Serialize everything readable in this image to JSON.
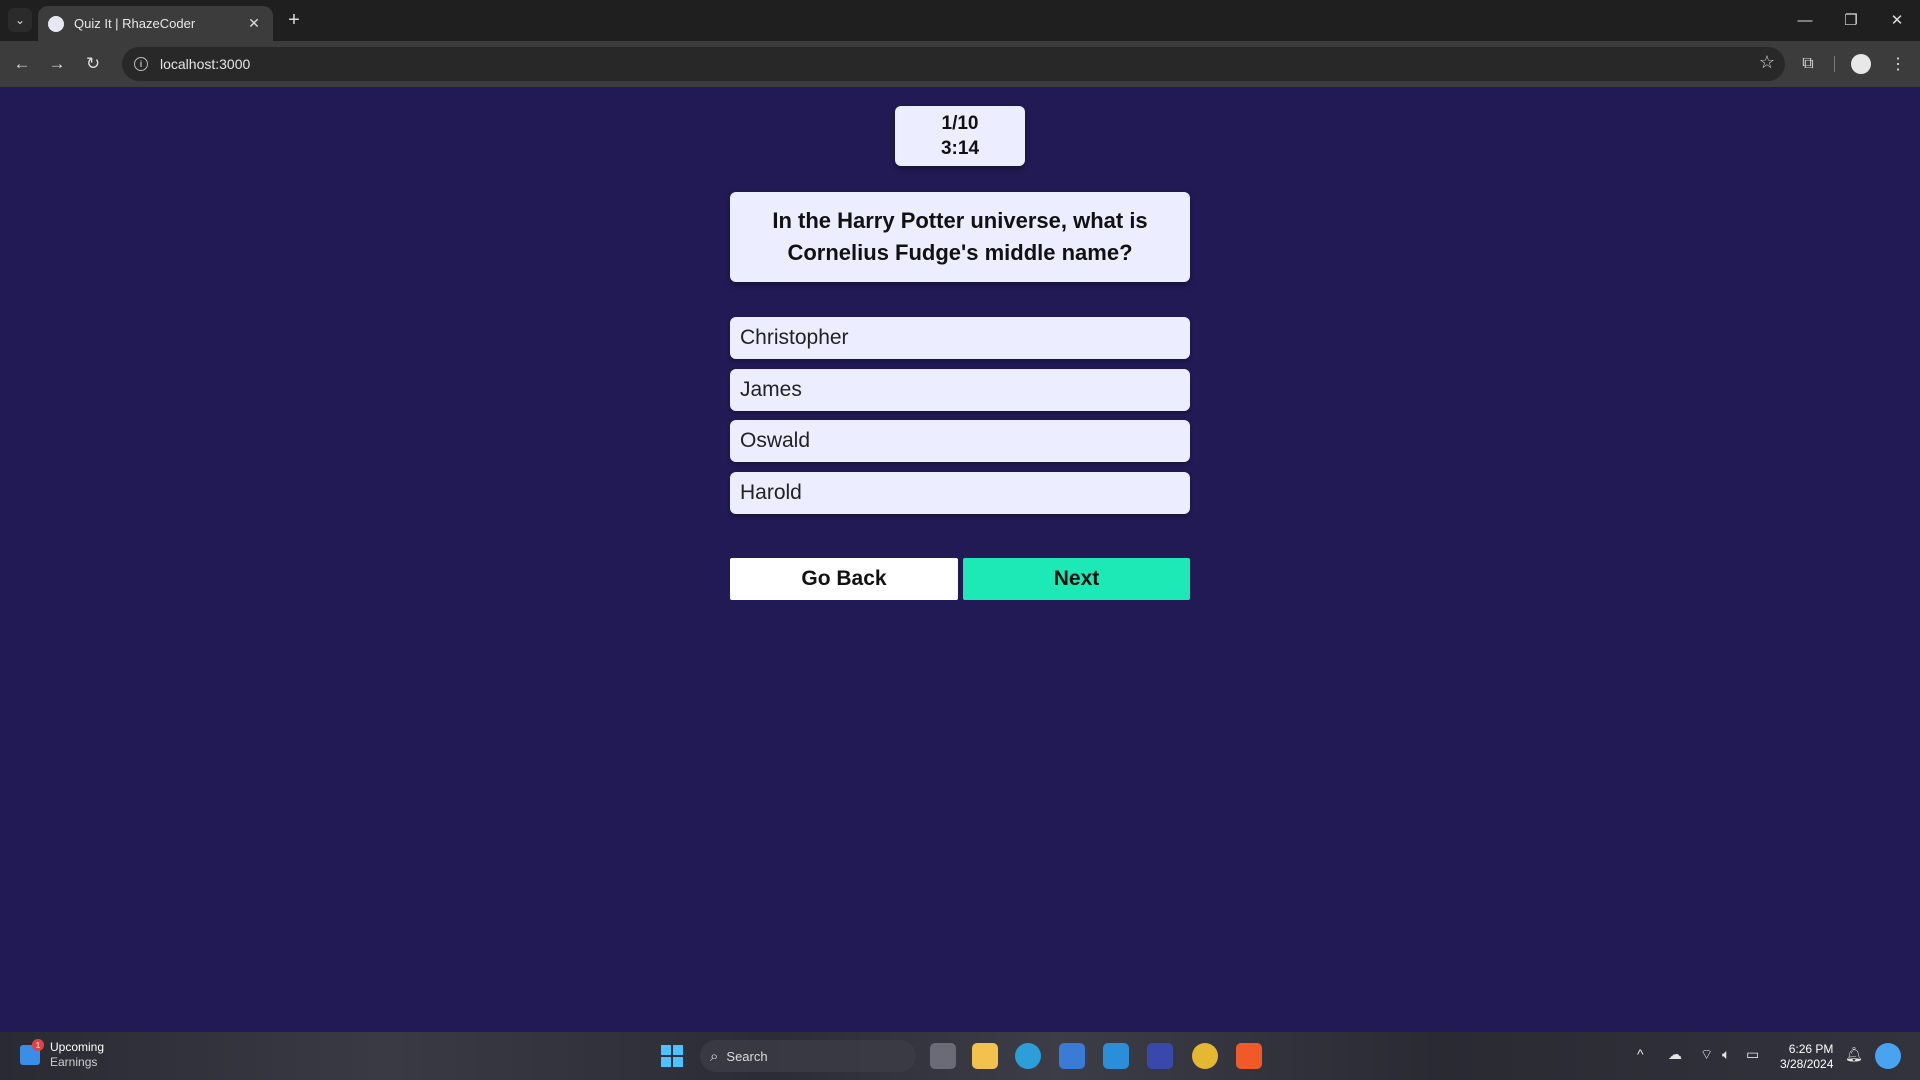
{
  "browser": {
    "tab_title": "Quiz It | RhazeCoder",
    "url": "localhost:3000"
  },
  "quiz": {
    "progress": "1/10",
    "timer": "3:14",
    "question": "In the Harry Potter universe, what is Cornelius Fudge's middle name?",
    "answers": [
      "Christopher",
      "James",
      "Oswald",
      "Harold"
    ],
    "back_label": "Go Back",
    "next_label": "Next"
  },
  "taskbar": {
    "widget_title": "Upcoming",
    "widget_subtitle": "Earnings",
    "widget_badge": "1",
    "search_label": "Search",
    "time": "6:26 PM",
    "date": "3/28/2024"
  },
  "colors": {
    "page_bg": "#221a55",
    "card_bg": "#eceeff",
    "next_button": "#1de9b6"
  }
}
